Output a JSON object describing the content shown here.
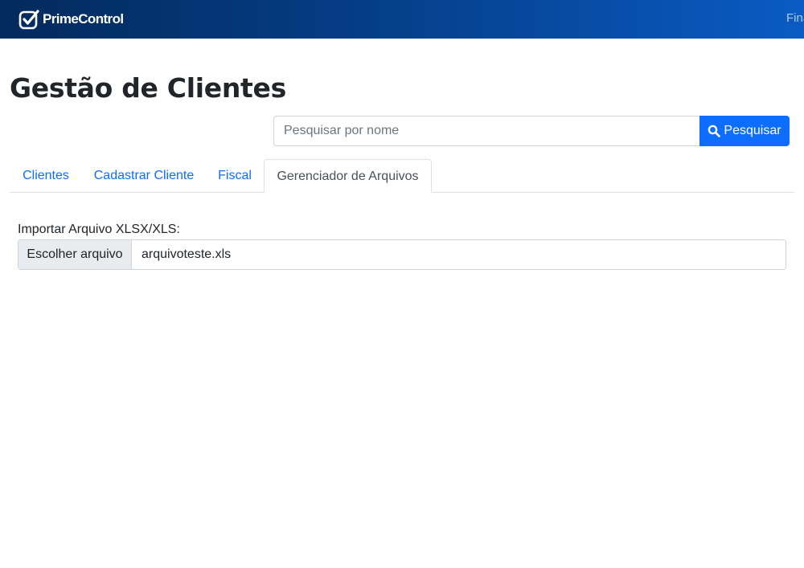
{
  "navbar": {
    "brand": "PrimeControl",
    "brand_icon": "checkbox-logo-icon",
    "right_link": "Fina"
  },
  "page": {
    "title": "Gestão de Clientes"
  },
  "search": {
    "placeholder": "Pesquisar por nome",
    "value": "",
    "button_label": "Pesquisar",
    "button_icon": "search-icon",
    "button_color": "#0d6efd"
  },
  "tabs": [
    {
      "label": "Clientes",
      "active": false
    },
    {
      "label": "Cadastrar Cliente",
      "active": false
    },
    {
      "label": "Fiscal",
      "active": false
    },
    {
      "label": "Gerenciador de Arquivos",
      "active": true
    }
  ],
  "file_import": {
    "label": "Importar Arquivo XLSX/XLS:",
    "button_label": "Escolher arquivo",
    "file_name": "arquivoteste.xls"
  },
  "colors": {
    "navbar_start": "#032a5c",
    "navbar_end": "#0a5bc4",
    "link": "#0d6efd",
    "active_tab_text": "#495057"
  }
}
